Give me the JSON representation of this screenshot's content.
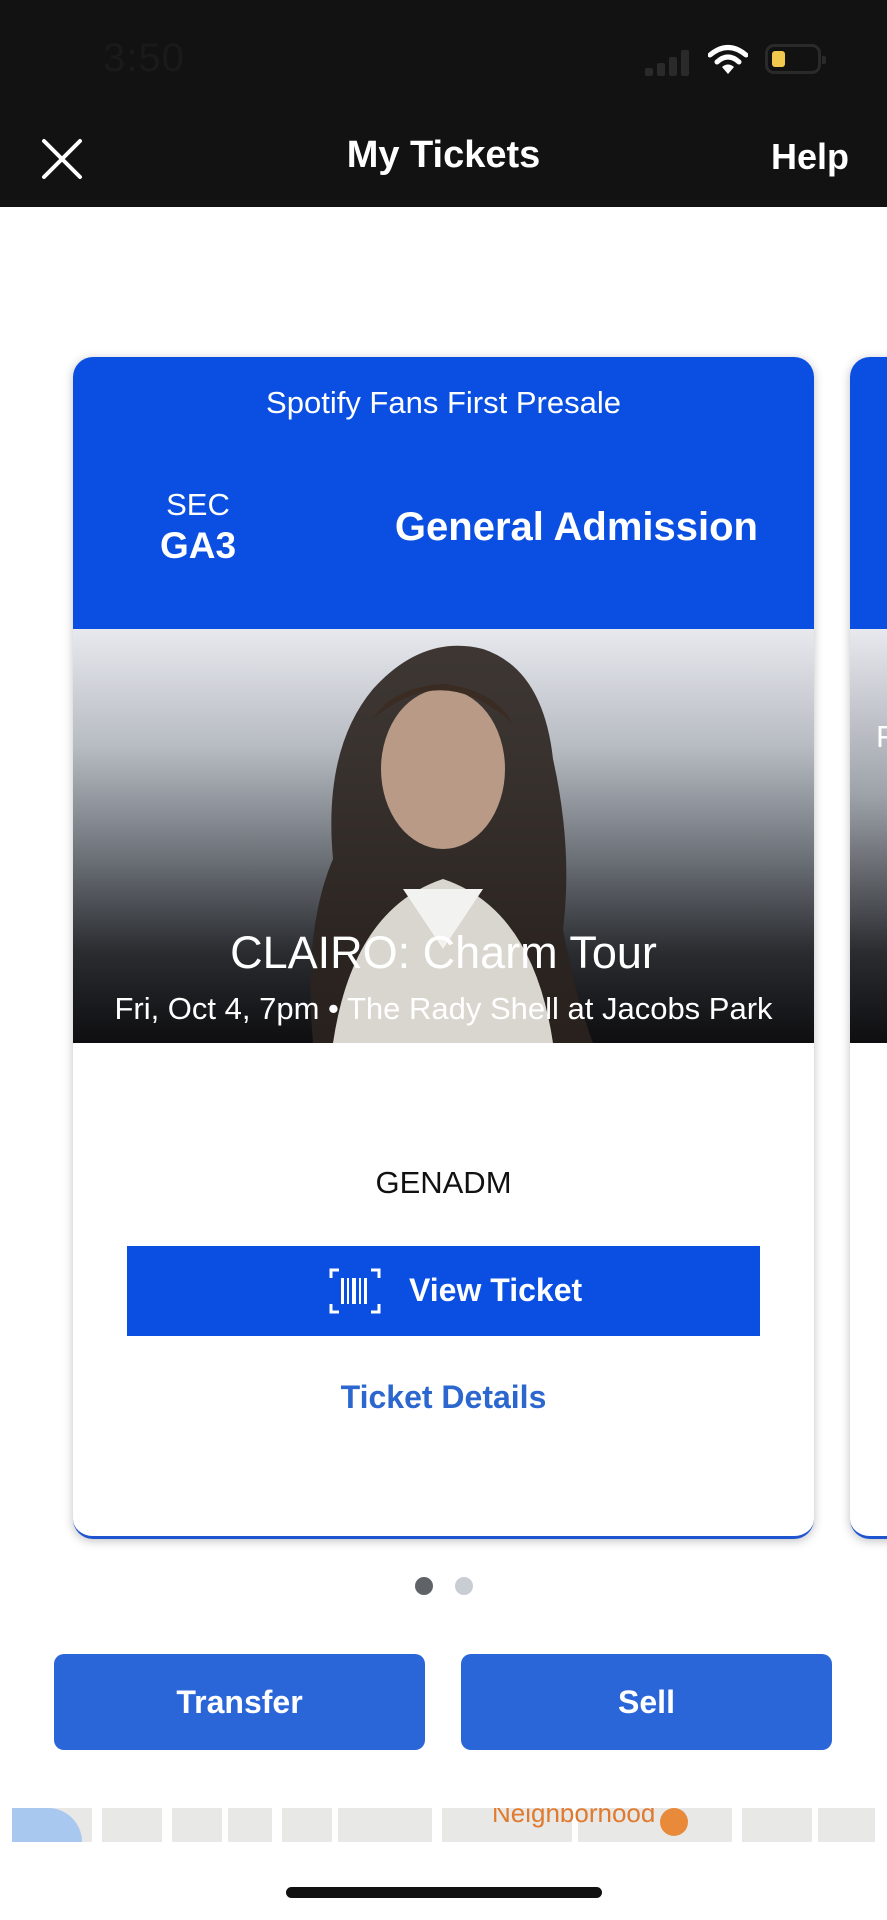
{
  "status_bar": {
    "time": "3:50"
  },
  "nav": {
    "title": "My Tickets",
    "help_label": "Help"
  },
  "ticket": {
    "presale": "Spotify Fans First Presale",
    "section_label": "SEC",
    "section_value": "GA3",
    "admission": "General Admission",
    "event_title": "CLAIRO: Charm Tour",
    "event_subtitle": "Fri, Oct 4, 7pm • The Rady Shell at Jacobs Park",
    "entry_code": "GENADM",
    "view_ticket_label": "View Ticket",
    "details_link": "Ticket Details"
  },
  "next_ticket": {
    "subtitle_peek": "F"
  },
  "pagination": {
    "total": 2,
    "current": 1
  },
  "actions": {
    "transfer_label": "Transfer",
    "sell_label": "Sell"
  },
  "map": {
    "poi_label": "Neighborhood"
  },
  "colors": {
    "ticket_blue": "#0a4fe1",
    "action_blue": "#2b66d9",
    "link_blue": "#2c67cf",
    "topbar": "#121212"
  }
}
